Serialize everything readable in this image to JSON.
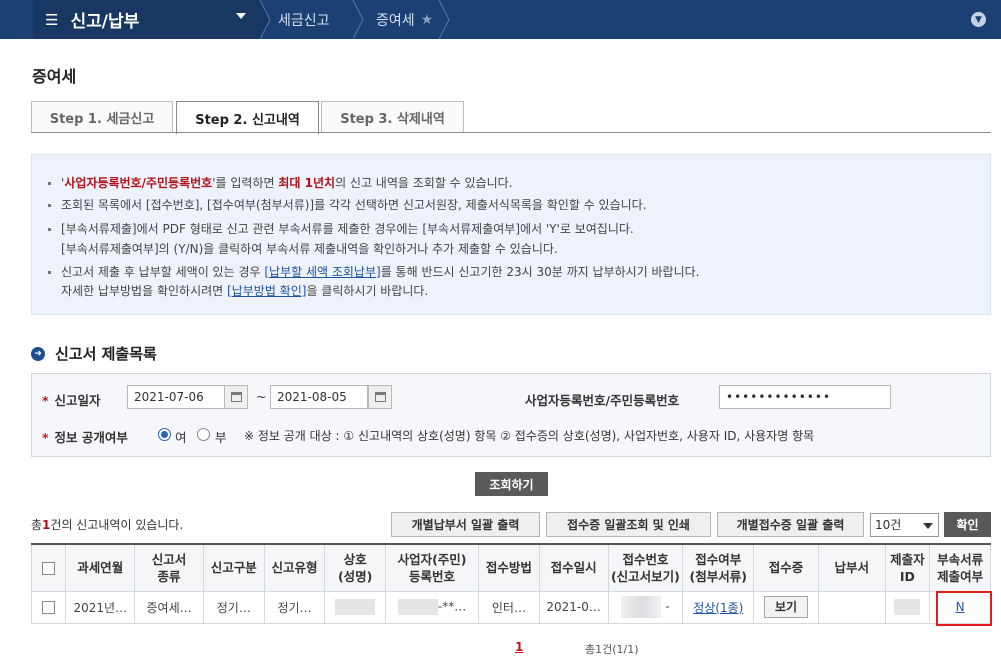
{
  "nav": {
    "menu": "신고/납부",
    "breadcrumbs": [
      "세금신고",
      "증여세"
    ]
  },
  "page_title": "증여세",
  "tabs": [
    "Step 1. 세금신고",
    "Step 2. 신고내역",
    "Step 3. 삭제내역"
  ],
  "info": {
    "line1": {
      "a": "'",
      "b": "사업자등록번호/주민등록번호",
      "c": "'를 입력하면 ",
      "d": "최대 1년치",
      "e": "의 신고 내역을 조회할 수 있습니다."
    },
    "line2": "조회된 목록에서 [접수번호], [접수여부(첨부서류)]를 각각 선택하면 신고서원장, 제출서식목록을 확인할 수 있습니다.",
    "line3": "[부속서류제출]에서 PDF 형태로 신고 관련 부속서류를 제출한 경우에는 [부속서류제출여부]에서 'Y'로 보여집니다.",
    "line4": "[부속서류제출여부]의 (Y/N)을 클릭하여 부속서류 제출내역을 확인하거나 추가 제출할 수 있습니다.",
    "line5": {
      "a": "신고서 제출 후 납부할 세액이 있는 경우 ",
      "link": "[납부할 세액 조회납부]",
      "b": "를 통해 반드시 신고기한 23시 30분 까지 납부하시기 바랍니다."
    },
    "line6": {
      "a": "자세한 납부방법을 확인하시려면 ",
      "link": "[납부방법 확인]",
      "b": "을 클릭하시기 바랍니다."
    }
  },
  "section_title": "신고서 제출목록",
  "search": {
    "date_label": "신고일자",
    "date_from": "2021-07-06",
    "tilde": "~",
    "date_to": "2021-08-05",
    "id_label": "사업자등록번호/주민등록번호",
    "id_value": "•••••••••••••",
    "public_label": "정보 공개여부",
    "yes": "여",
    "no": "부",
    "public_note": "※ 정보 공개 대상 : ① 신고내역의 상호(성명) 항목 ② 접수증의 상호(성명), 사업자번호, 사용자 ID, 사용자명 항목",
    "button": "조회하기"
  },
  "results": {
    "count_a": "총",
    "count_n": "1",
    "count_b": "건의 신고내역이 있습니다.",
    "btn1": "개별납부서 일괄 출력",
    "btn2": "접수증 일괄조회 및 인쇄",
    "btn3": "개별접수증 일괄 출력",
    "page_size": "10건",
    "ok": "확인"
  },
  "table": {
    "headers": [
      {
        "l1": "과세연월",
        "l2": ""
      },
      {
        "l1": "신고서",
        "l2": "종류"
      },
      {
        "l1": "신고구분",
        "l2": ""
      },
      {
        "l1": "신고유형",
        "l2": ""
      },
      {
        "l1": "상호",
        "l2": "(성명)"
      },
      {
        "l1": "사업자(주민)",
        "l2": "등록번호"
      },
      {
        "l1": "접수방법",
        "l2": ""
      },
      {
        "l1": "접수일시",
        "l2": ""
      },
      {
        "l1": "접수번호",
        "l2": "(신고서보기)"
      },
      {
        "l1": "접수여부",
        "l2": "(첨부서류)"
      },
      {
        "l1": "접수증",
        "l2": ""
      },
      {
        "l1": "납부서",
        "l2": ""
      },
      {
        "l1": "제출자",
        "l2": "ID"
      },
      {
        "l1": "부속서류",
        "l2": "제출여부"
      }
    ],
    "row": {
      "period": "2021년…",
      "type": "증여세…",
      "category": "정기…",
      "kind": "정기…",
      "id_suffix": "-**…",
      "method": "인터…",
      "datetime": "2021-0…",
      "dash": "-",
      "status": "정상(1종)",
      "view": "보기",
      "attach": "N"
    }
  },
  "pager": {
    "current": "1",
    "info": "총1건(1/1)"
  },
  "colors": {
    "nav_bg": "#1c3f74",
    "accent_red": "#b3101b",
    "link_blue": "#1e53a7",
    "highlight": "#e41b1b"
  }
}
